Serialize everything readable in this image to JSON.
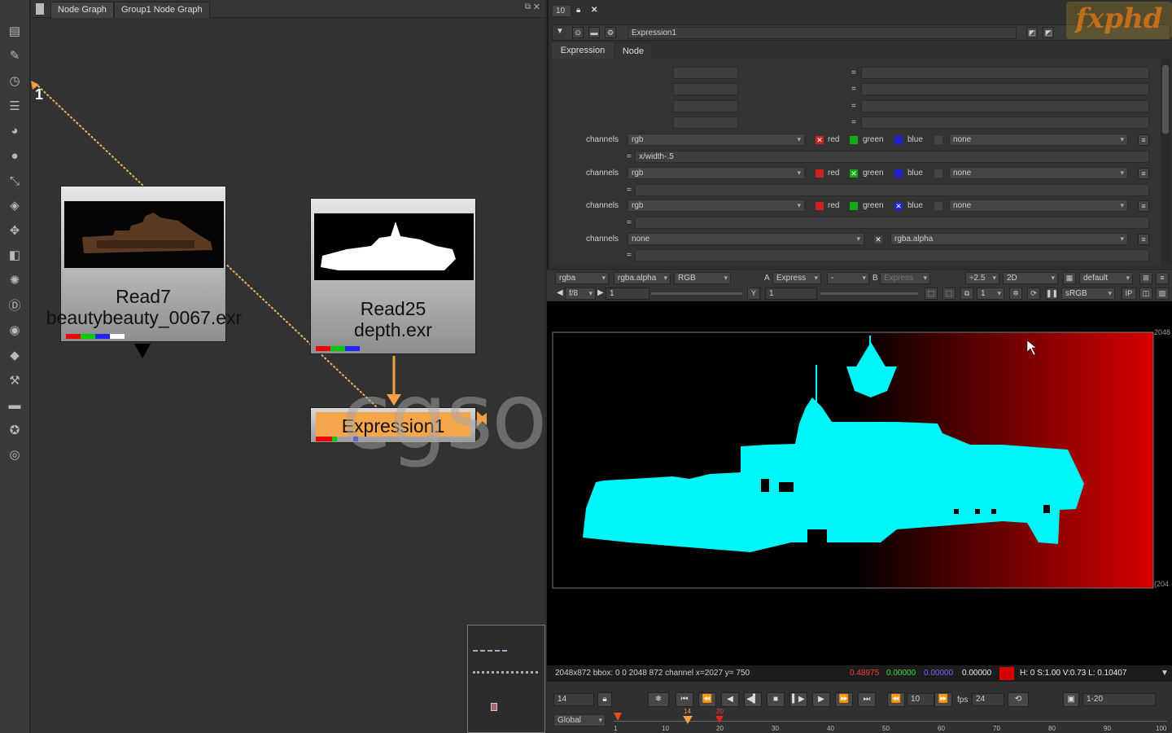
{
  "node_graph": {
    "tabs": [
      "Node Graph",
      "Group1 Node Graph"
    ],
    "input_number": "1",
    "nodes": [
      {
        "title": "Read7",
        "file": "beautybeauty_0067.exr"
      },
      {
        "title": "Read25",
        "file": "depth.exr"
      },
      {
        "title": "Expression1"
      }
    ],
    "watermark": "cgsop.com"
  },
  "toolbar": {
    "icons": [
      "image-icon",
      "draw-icon",
      "time-icon",
      "channel-icon",
      "color-icon",
      "filter-icon",
      "keyer-icon",
      "merge-icon",
      "transform-icon",
      "3d-icon",
      "particles-icon",
      "deep-icon",
      "views-icon",
      "metadata-icon",
      "toolsets-icon",
      "other-icon",
      "furnace-icon",
      "ocula-icon"
    ]
  },
  "properties": {
    "top_value": "10",
    "node_name": "Expression1",
    "tabs": [
      "Expression",
      "Node"
    ],
    "eq": "=",
    "expressions": [
      {
        "channels": "rgb",
        "red": true,
        "green": false,
        "blue": false,
        "extra": "none",
        "expr": "x/width-.5"
      },
      {
        "channels": "rgb",
        "red": false,
        "green": true,
        "blue": false,
        "extra": "none",
        "expr": ""
      },
      {
        "channels": "rgb",
        "red": false,
        "green": false,
        "blue": true,
        "extra": "none",
        "expr": ""
      },
      {
        "channels": "none",
        "alpha_channel": "rgba.alpha",
        "expr": ""
      }
    ],
    "labels": {
      "channels": "channels",
      "red": "red",
      "green": "green",
      "blue": "blue"
    }
  },
  "logo": "fxphd",
  "viewer": {
    "bar1": {
      "channels": "rgba",
      "alpha": "rgba.alpha",
      "display": "RGB",
      "a_label": "A",
      "a_input": "Express",
      "a_op": "-",
      "b_label": "B",
      "b_input": "Express",
      "gain": "÷2.5",
      "mode": "2D",
      "lut_default": "default"
    },
    "bar2": {
      "fstop": "f/8",
      "gain_value": "1",
      "y_label": "Y",
      "gamma_value": "1",
      "proxy": "1",
      "lut": "sRGB",
      "ip": "IP"
    },
    "format_right_top": "2048",
    "format_right_bottom": "(204"
  },
  "info": {
    "text": "2048x872 bbox: 0 0 2048 872 channel  x=2027 y= 750",
    "r": "0.48975",
    "g": "0.00000",
    "b": "0.00000",
    "a": "0.00000",
    "hsvl": "H:  0 S:1.00 V:0.73  L: 0.10407",
    "swatch_color": "#d40000"
  },
  "timeline": {
    "current_frame": "14",
    "step": "10",
    "fps_label": "fps",
    "fps": "24",
    "range": "1-20",
    "global": "Global",
    "ticks": [
      "1",
      "10",
      "20",
      "30",
      "40",
      "50",
      "60",
      "70",
      "80",
      "90",
      "100"
    ],
    "markers": [
      "14",
      "20"
    ]
  }
}
